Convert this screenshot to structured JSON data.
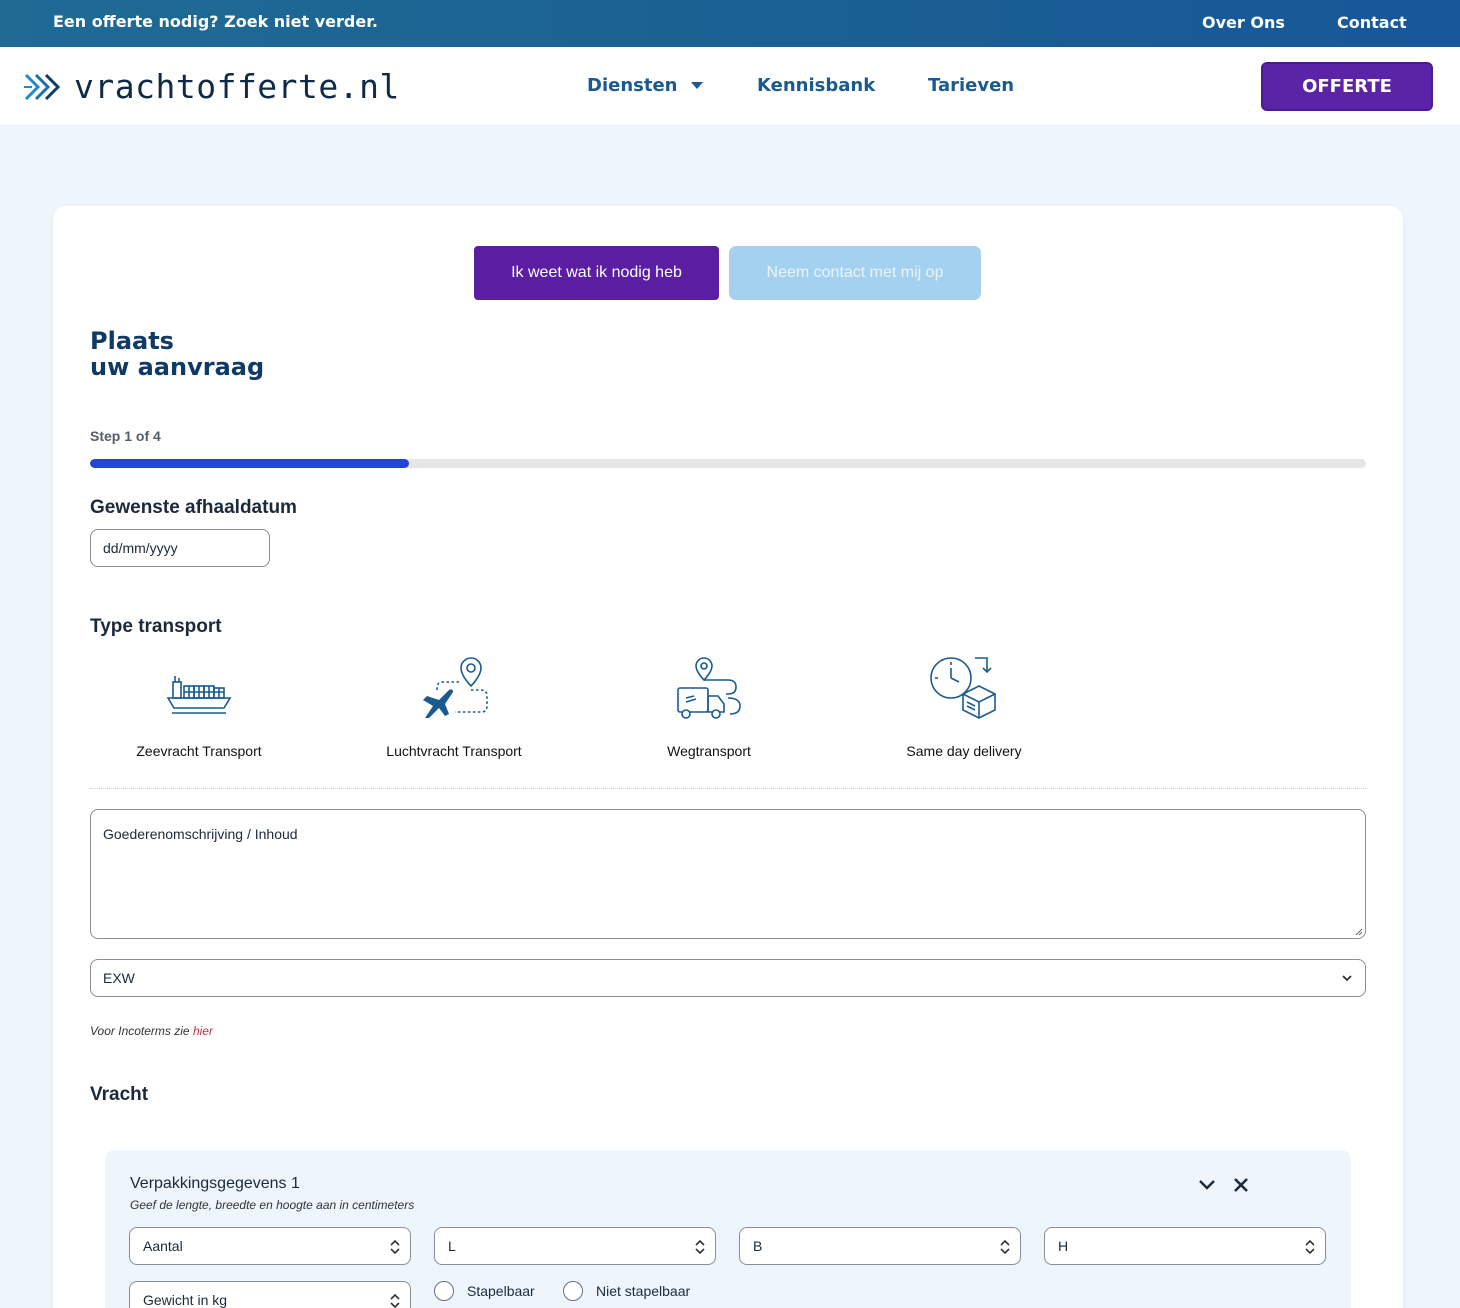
{
  "topbar": {
    "tagline": "Een offerte nodig? Zoek niet verder.",
    "links": [
      "Over Ons",
      "Contact"
    ]
  },
  "header": {
    "logo_text": "vrachtofferte.nl",
    "nav": {
      "diensten": "Diensten",
      "kennisbank": "Kennisbank",
      "tarieven": "Tarieven"
    },
    "cta_label": "OFFERTE"
  },
  "form": {
    "tabs": {
      "active": "Ik weet wat ik nodig heb",
      "inactive": "Neem contact met mij op"
    },
    "title_line1": "Plaats",
    "title_line2": "uw aanvraag",
    "step_text": "Step 1 of 4",
    "progress_fraction": 0.25,
    "pickup_label": "Gewenste afhaaldatum",
    "pickup_placeholder": "dd/mm/yyyy",
    "transport_label": "Type transport",
    "transport_options": [
      {
        "label": "Zeevracht Transport",
        "icon": "cargo-ship-icon"
      },
      {
        "label": "Luchtvracht Transport",
        "icon": "airplane-route-icon"
      },
      {
        "label": "Wegtransport",
        "icon": "truck-route-icon"
      },
      {
        "label": "Same day delivery",
        "icon": "clock-package-icon"
      }
    ],
    "goods_placeholder": "Goederenomschrijving / Inhoud",
    "incoterm_value": "EXW",
    "incoterm_note": "Voor Incoterms zie",
    "incoterm_link": "hier",
    "cargo_label": "Vracht",
    "package": {
      "title": "Verpakkingsgegevens 1",
      "subtitle": "Geef de lengte, breedte en hoogte aan in centimeters",
      "fields": {
        "aantal": "Aantal",
        "length": "L",
        "width": "B",
        "height": "H",
        "weight": "Gewicht in kg"
      },
      "stackable": "Stapelbaar",
      "not_stackable": "Niet stapelbaar"
    }
  },
  "colors": {
    "brand_purple": "#5b24a6",
    "brand_blue": "#1a5a8f",
    "progress_blue": "#2244d8",
    "link_red": "#c0304a"
  }
}
